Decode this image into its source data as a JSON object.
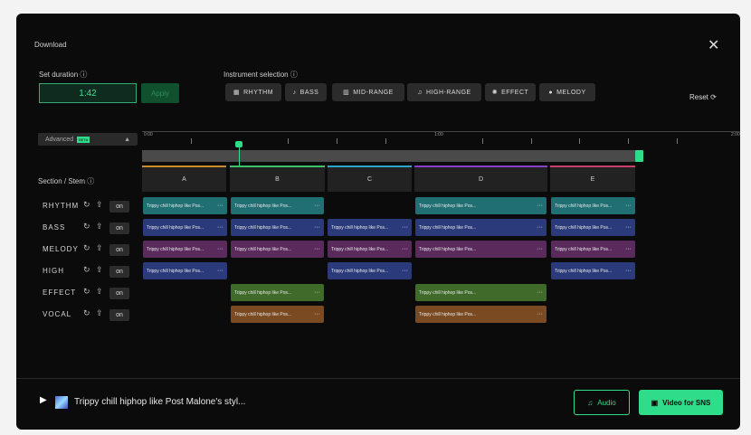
{
  "header": {
    "title": "Download",
    "close_icon": "close-icon"
  },
  "duration": {
    "label": "Set duration",
    "value": "1:42",
    "apply_label": "Apply"
  },
  "instrument": {
    "label": "Instrument selection",
    "buttons": [
      "RHYTHM",
      "BASS",
      "MID-RANGE",
      "HIGH-RANGE",
      "EFFECT",
      "MELODY"
    ]
  },
  "reset_label": "Reset",
  "advanced": {
    "label": "Advanced",
    "badge": "BETA"
  },
  "timeline": {
    "t0": "0:00",
    "t1": "1:00",
    "t2": "2:00"
  },
  "sections": [
    "A",
    "B",
    "C",
    "D",
    "E"
  ],
  "stem_header": "Section / Stem",
  "stems": [
    {
      "name": "RHYTHM",
      "on": "on"
    },
    {
      "name": "BASS",
      "on": "on"
    },
    {
      "name": "MELODY",
      "on": "on"
    },
    {
      "name": "HIGH",
      "on": "on"
    },
    {
      "name": "EFFECT",
      "on": "on"
    },
    {
      "name": "VOCAL",
      "on": "on"
    }
  ],
  "clip_text": "Trippy chill hiphop like Pos...",
  "clip_dots": "···",
  "player": {
    "title": "Trippy chill hiphop like Post Malone's styl..."
  },
  "actions": {
    "audio": "Audio",
    "video": "Video for SNS"
  },
  "colors": {
    "rhythm": "#1f6f73",
    "bass": "#2a3a7a",
    "melody": "#5a2a5c",
    "high": "#2a3a7a",
    "effect": "#3f6a2a",
    "vocal": "#7a4a22",
    "accent": "#2fdc8a"
  }
}
